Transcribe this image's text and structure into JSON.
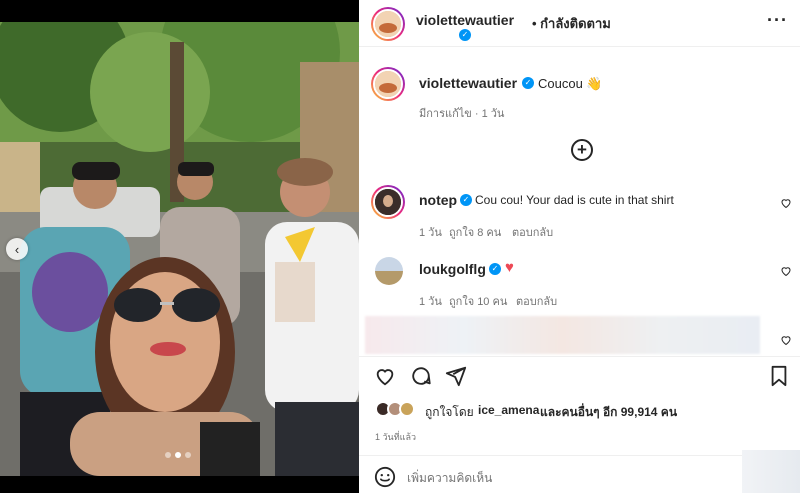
{
  "post": {
    "author": "violettewautier",
    "follow_status": "• กำลังติดตาม",
    "caption_user": "violettewautier",
    "caption_text": "Coucou 👋",
    "caption_meta": "มีการแก้ไข · 1 วัน"
  },
  "comments": [
    {
      "user": "notep",
      "text": "Cou cou! Your dad is cute in that shirt",
      "time": "1 วัน",
      "likes": "ถูกใจ 8 คน",
      "reply": "ตอบกลับ"
    },
    {
      "user": "loukgolflg",
      "text": "♥",
      "time": "1 วัน",
      "likes": "ถูกใจ 10 คน",
      "reply": "ตอบกลับ"
    }
  ],
  "likes_summary": {
    "prefix": "ถูกใจโดย",
    "user": "ice_amena",
    "suffix": "และคนอื่นๆ อีก 99,914 คน"
  },
  "post_time": "1 วันที่แล้ว",
  "comment_input": {
    "placeholder": "เพิ่มความคิดเห็น"
  },
  "icons": {
    "more": "more-icon",
    "load_more": "plus-circle-icon",
    "like": "heart-icon",
    "comment": "comment-icon",
    "share": "send-icon",
    "save": "bookmark-icon",
    "emoji": "emoji-icon",
    "prev": "chevron-left-icon"
  },
  "colors": {
    "verified": "#0095f6",
    "heart": "#ed4956",
    "text": "#262626",
    "muted": "#737373"
  }
}
